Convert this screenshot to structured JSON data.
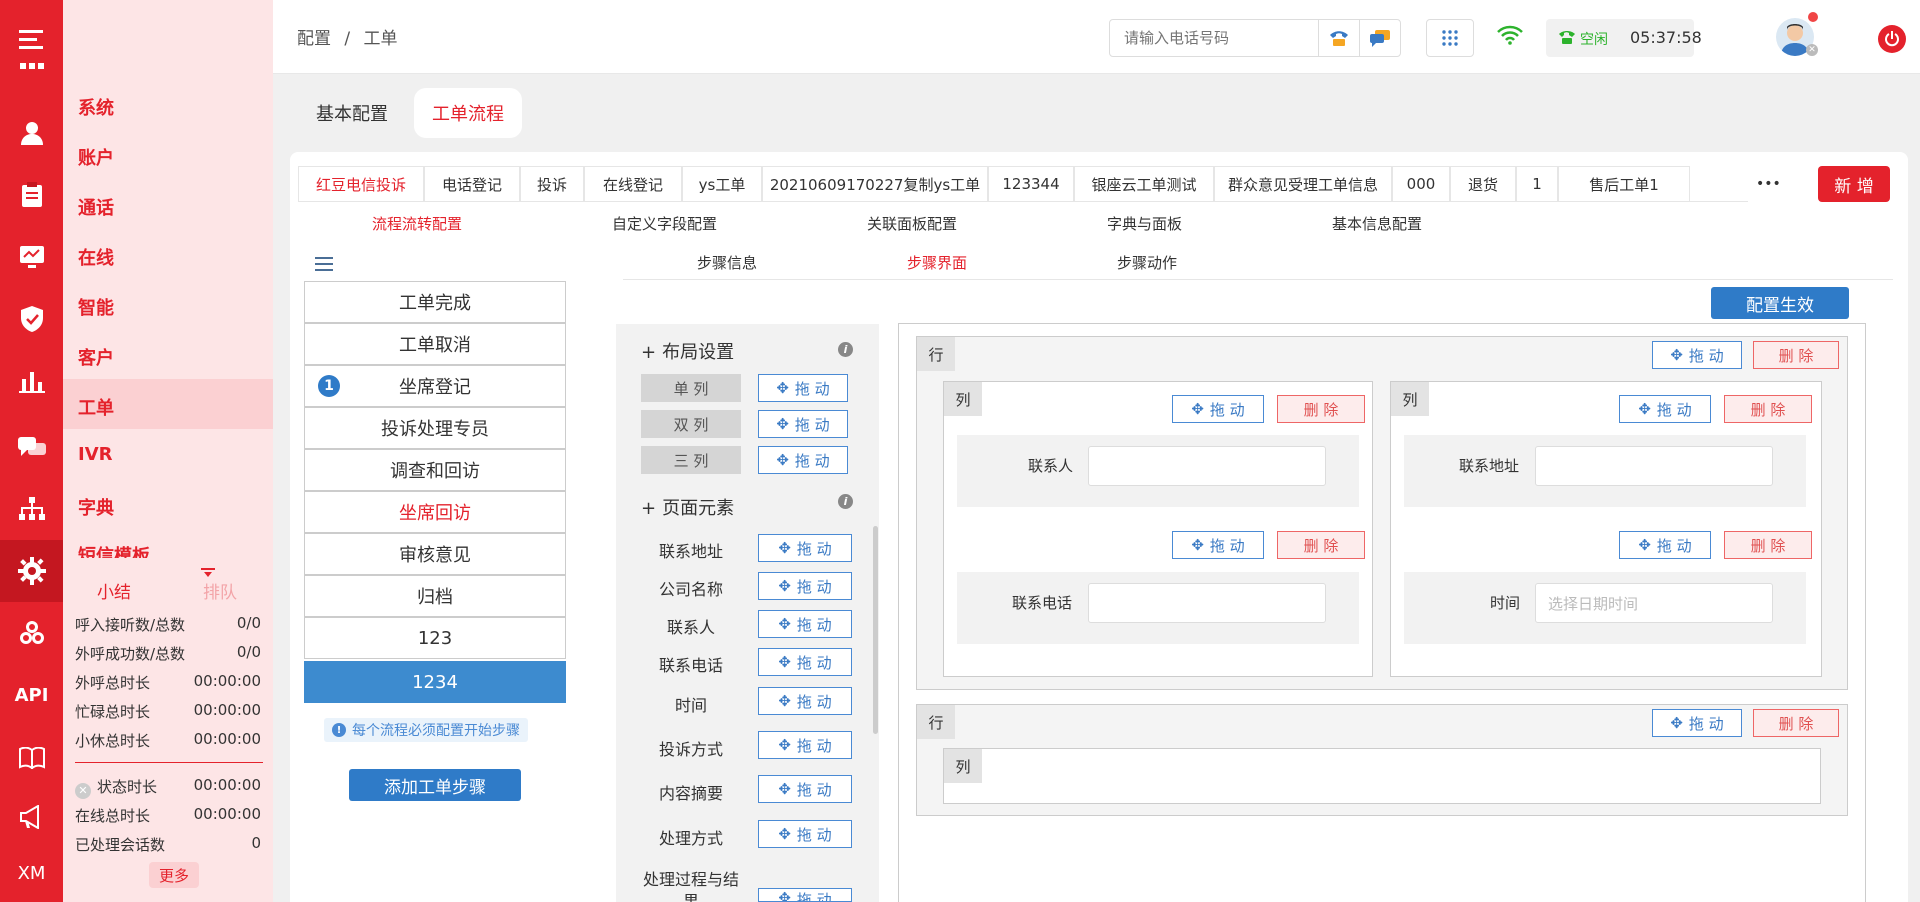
{
  "nav_rail": {
    "api_label": "API",
    "xm_label": "XM"
  },
  "menu": {
    "items": [
      "系统",
      "账户",
      "通话",
      "在线",
      "智能",
      "客户",
      "工单",
      "IVR",
      "字典",
      "短信模板"
    ]
  },
  "stats": {
    "tab_summary": "小结",
    "tab_queue": "排队",
    "rows": [
      {
        "label": "呼入接听数/总数",
        "value": "0/0"
      },
      {
        "label": "外呼成功数/总数",
        "value": "0/0"
      },
      {
        "label": "外呼总时长",
        "value": "00:00:00"
      },
      {
        "label": "忙碌总时长",
        "value": "00:00:00"
      },
      {
        "label": "小休总时长",
        "value": "00:00:00"
      },
      {
        "label": "状态时长",
        "value": "00:00:00"
      },
      {
        "label": "在线总时长",
        "value": "00:00:00"
      },
      {
        "label": "已处理会话数",
        "value": "0"
      }
    ],
    "more": "更多"
  },
  "header": {
    "breadcrumb_root": "配置",
    "breadcrumb_sep": "/",
    "breadcrumb_current": "工单",
    "phone_placeholder": "请输入电话号码",
    "status_label": "空闲",
    "clock": "05:37:58"
  },
  "page_tabs": [
    "基本配置",
    "工单流程"
  ],
  "workflow_tabs": [
    "红豆电信投诉",
    "电话登记",
    "投诉",
    "在线登记",
    "ys工单",
    "20210609170227复制ys工单",
    "123344",
    "银座云工单测试",
    "群众意见受理工单信息",
    "000",
    "退货",
    "1",
    "售后工单1"
  ],
  "more_tabs": "•••",
  "new_button": "新 增",
  "config_tabs": [
    "流程流转配置",
    "自定义字段配置",
    "关联面板配置",
    "字典与面板",
    "基本信息配置"
  ],
  "step_tabs": [
    "步骤信息",
    "步骤界面",
    "步骤动作"
  ],
  "steps": [
    "工单完成",
    "工单取消",
    "坐席登记",
    "投诉处理专员",
    "调查和回访",
    "坐席回访",
    "审核意见",
    "归档",
    "123",
    "1234"
  ],
  "step_badge": "1",
  "step_hint": "每个流程必须配置开始步骤",
  "add_step_button": "添加工单步骤",
  "apply_button": "配置生效",
  "layout_section": {
    "title": "布局设置",
    "options": [
      "单 列",
      "双 列",
      "三 列"
    ]
  },
  "element_section": {
    "title": "页面元素",
    "items": [
      "联系地址",
      "公司名称",
      "联系人",
      "联系电话",
      "时间",
      "投诉方式",
      "内容摘要",
      "处理方式",
      "处理过程与结果"
    ]
  },
  "drag_label": "拖 动",
  "delete_label": "删 除",
  "row_label": "行",
  "col_label": "列",
  "form_fields": {
    "contact": "联系人",
    "phone": "联系电话",
    "address": "联系地址",
    "time": "时间",
    "time_placeholder": "选择日期时间"
  }
}
